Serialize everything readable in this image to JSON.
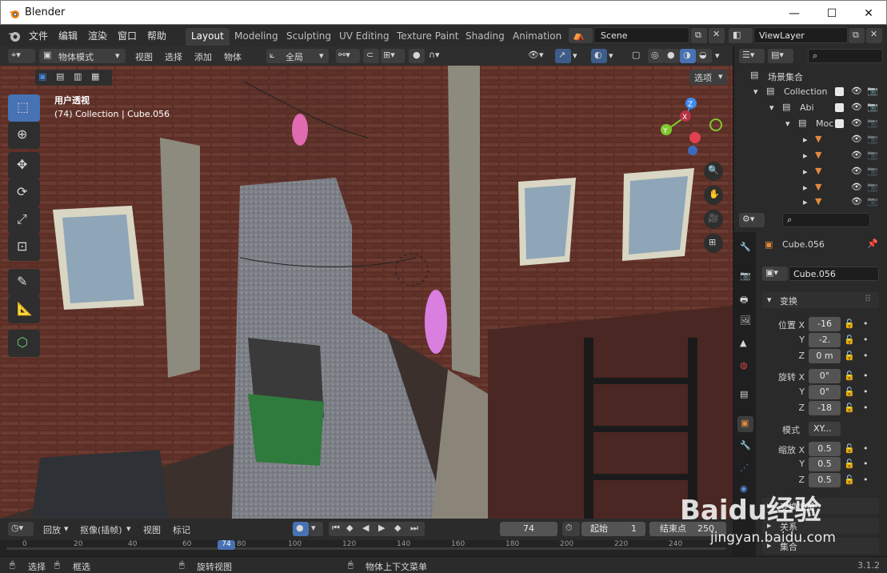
{
  "window": {
    "title": "Blender",
    "min": "—",
    "max": "☐",
    "close": "✕"
  },
  "menu": [
    "文件",
    "编辑",
    "渲染",
    "窗口",
    "帮助"
  ],
  "workspaces": [
    "Layout",
    "Modeling",
    "Sculpting",
    "UV Editing",
    "Texture Paint",
    "Shading",
    "Animation"
  ],
  "scene": {
    "label": "Scene"
  },
  "view_layer": {
    "label": "ViewLayer"
  },
  "viewport_header": {
    "mode": "物体模式",
    "menus": [
      "视图",
      "选择",
      "添加",
      "物体"
    ],
    "transform_orientation": "全局",
    "options": "选项"
  },
  "viewport": {
    "overlay_line1": "用户透视",
    "overlay_line2": "(74) Collection | Cube.056",
    "gizmo_axes": [
      "X",
      "Y",
      "Z"
    ],
    "colors": {
      "active_tool": "#4772b3",
      "x": "#e0404f",
      "y": "#7fc92f",
      "z": "#3d8bf0"
    }
  },
  "outliner": {
    "root": "场景集合",
    "rows": [
      {
        "label": "Collection"
      },
      {
        "label": "Abi"
      },
      {
        "label": "Moc"
      }
    ]
  },
  "properties": {
    "object_name": "Cube.056",
    "data_name": "Cube.056",
    "panel_title": "变换",
    "location_label": "位置 X",
    "location": {
      "x": "-16",
      "y": "-2.",
      "z": "0 m"
    },
    "rotation_label": "旋转 X",
    "rotation": {
      "x": "0°",
      "y": "0°",
      "z": "-18"
    },
    "mode_label": "模式",
    "mode_value": "XY...",
    "scale_label": "缩放 X",
    "scale": {
      "x": "0.5",
      "y": "0.5",
      "z": "0.5"
    },
    "axis_y": "Y",
    "axis_z": "Z",
    "delta_transform": "变换增量",
    "relations": "关系",
    "collections": "集合"
  },
  "timeline": {
    "playback": "回放",
    "keying": "抠像(插帧)",
    "view": "视图",
    "marker": "标记",
    "current_frame": "74",
    "start_label": "起始",
    "start": "1",
    "end_label": "结束点",
    "end": "250"
  },
  "ruler_ticks": [
    "0",
    "20",
    "40",
    "60",
    "74",
    "80",
    "100",
    "120",
    "140",
    "160",
    "180",
    "200",
    "220",
    "240"
  ],
  "statusbar": {
    "select": "选择",
    "box_select": "框选",
    "rotate_view": "旋转视图",
    "context_menu": "物体上下文菜单",
    "version": "3.1.2"
  },
  "watermark": {
    "text": "Baidu经验",
    "url": "jingyan.baidu.com"
  }
}
